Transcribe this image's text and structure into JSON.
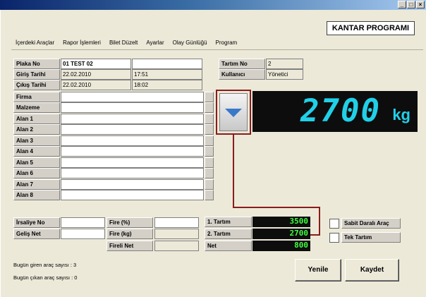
{
  "window": {
    "minimize": "_",
    "maximize": "□",
    "close": "×"
  },
  "app_title": "KANTAR PROGRAMI",
  "menu": [
    "İçerdeki Araçlar",
    "Rapor İşlemleri",
    "Bilet Düzelt",
    "Ayarlar",
    "Olay Günlüğü",
    "Program"
  ],
  "plaka": {
    "label": "Plaka No",
    "value": "01 TEST 02",
    "extra": ""
  },
  "giris": {
    "label": "Giriş Tarihi",
    "date": "22.02.2010",
    "time": "17:51"
  },
  "cikis": {
    "label": "Çıkış Tarihi",
    "date": "22.02.2010",
    "time": "18:02"
  },
  "info_fields": [
    {
      "label": "Firma",
      "value": ""
    },
    {
      "label": "Malzeme",
      "value": ""
    },
    {
      "label": "Alan 1",
      "value": ""
    },
    {
      "label": "Alan 2",
      "value": ""
    },
    {
      "label": "Alan 3",
      "value": ""
    },
    {
      "label": "Alan 4",
      "value": ""
    },
    {
      "label": "Alan 5",
      "value": ""
    },
    {
      "label": "Alan 6",
      "value": ""
    },
    {
      "label": "Alan 7",
      "value": ""
    },
    {
      "label": "Alan 8",
      "value": ""
    }
  ],
  "tartim_no": {
    "label": "Tartım No",
    "value": "2"
  },
  "kullanici": {
    "label": "Kullanıcı",
    "value": "Yönetici"
  },
  "scale": {
    "reading": "2700",
    "unit": "kg",
    "display_color": "#20d0e8"
  },
  "irsaliye": {
    "label": "İrsaliye No",
    "value": ""
  },
  "gelis_net": {
    "label": "Geliş Net",
    "value": ""
  },
  "fire_pct": {
    "label": "Fire (%)",
    "value": ""
  },
  "fire_kg": {
    "label": "Fire (kg)",
    "value": ""
  },
  "fireli_net": {
    "label": "Fireli Net",
    "value": ""
  },
  "tartim1": {
    "label": "1. Tartım",
    "value": "3500"
  },
  "tartim2": {
    "label": "2. Tartım",
    "value": "2700"
  },
  "net": {
    "label": "Net",
    "value": "800"
  },
  "sabit": {
    "label": "Sabit Daralı Araç",
    "checked": false
  },
  "tek": {
    "label": "Tek Tartım",
    "checked": false
  },
  "buttons": {
    "yenile": "Yenile",
    "kaydet": "Kaydet"
  },
  "status": {
    "giren": "Bugün giren araç sayısı : 3",
    "cikan": "Bugün çıkan araç sayısı : 0"
  },
  "colors": {
    "accent_wire": "#8a1c1c",
    "lcd_text": "#20d0e8",
    "weight_text": "#40ff40"
  }
}
